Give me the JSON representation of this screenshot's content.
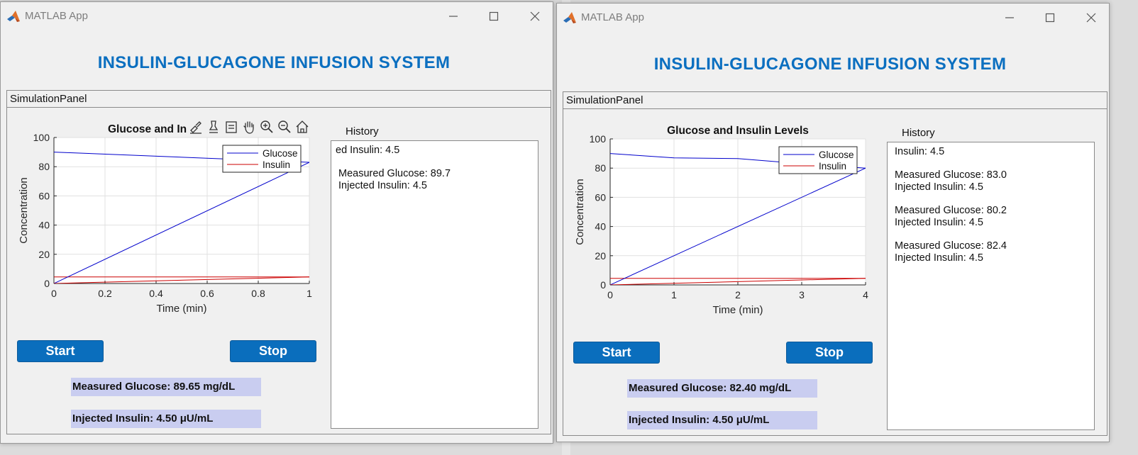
{
  "windows": [
    {
      "window_title": "MATLAB App",
      "app_title": "INSULIN-GLUCAGONE INFUSION SYSTEM",
      "panel_title": "SimulationPanel",
      "chart_title_visible": "Glucose and In",
      "history_label": "History",
      "history_lines": [
        "ed Insulin: 4.5",
        "",
        " Measured Glucose: 89.7",
        " Injected Insulin: 4.5"
      ],
      "start_label": "Start",
      "stop_label": "Stop",
      "glucose_readout": "Measured Glucose: 89.65 mg/dL",
      "insulin_readout": "Injected Insulin: 4.50 μU/mL",
      "axes_toolbar_icons": [
        "brush-icon",
        "data-tips-icon",
        "restore-icon",
        "pan-icon",
        "zoom-in-icon",
        "zoom-out-icon",
        "home-icon"
      ]
    },
    {
      "window_title": "MATLAB App",
      "app_title": "INSULIN-GLUCAGONE INFUSION SYSTEM",
      "panel_title": "SimulationPanel",
      "chart_title_visible": "Glucose and Insulin Levels",
      "history_label": "History",
      "history_lines": [
        "Insulin: 4.5",
        "",
        "Measured Glucose: 83.0",
        "Injected Insulin: 4.5",
        "",
        "Measured Glucose: 80.2",
        "Injected Insulin: 4.5",
        "",
        "Measured Glucose: 82.4",
        "Injected Insulin: 4.5"
      ],
      "start_label": "Start",
      "stop_label": "Stop",
      "glucose_readout": "Measured Glucose: 82.40 mg/dL",
      "insulin_readout": "Injected Insulin: 4.50 μU/mL",
      "axes_toolbar_icons": []
    }
  ],
  "chart_data": [
    {
      "type": "line",
      "title": "Glucose and Insulin Levels",
      "xlabel": "Time (min)",
      "ylabel": "Concentration",
      "xlim": [
        0,
        1
      ],
      "ylim": [
        0,
        100
      ],
      "xticks": [
        0,
        0.2,
        0.4,
        0.6,
        0.8,
        1
      ],
      "xtick_labels": [
        "0",
        "0.2",
        "0.4",
        "0.6",
        "0.8",
        "1"
      ],
      "yticks": [
        0,
        20,
        40,
        60,
        80,
        100
      ],
      "grid": true,
      "legend": "top-right",
      "series": [
        {
          "name": "Glucose",
          "color": "#0000cc",
          "x": [
            0,
            1
          ],
          "y": [
            90,
            83
          ]
        },
        {
          "name": "Insulin",
          "color": "#cc0000",
          "x": [
            0,
            1
          ],
          "y": [
            4.5,
            4.5
          ]
        },
        {
          "name": "",
          "color": "#0000cc",
          "x": [
            0,
            1
          ],
          "y": [
            0,
            83
          ]
        },
        {
          "name": "",
          "color": "#cc0000",
          "x": [
            0,
            1
          ],
          "y": [
            0,
            4.5
          ]
        }
      ],
      "colors": {
        "glucose": "#0000cc",
        "insulin": "#cc0000"
      }
    },
    {
      "type": "line",
      "title": "Glucose and Insulin Levels",
      "xlabel": "Time (min)",
      "ylabel": "Concentration",
      "xlim": [
        0,
        4
      ],
      "ylim": [
        0,
        100
      ],
      "xticks": [
        0,
        1,
        2,
        3,
        4
      ],
      "xtick_labels": [
        "0",
        "1",
        "2",
        "3",
        "4"
      ],
      "yticks": [
        0,
        20,
        40,
        60,
        80,
        100
      ],
      "grid": true,
      "legend": "top-right",
      "series": [
        {
          "name": "Glucose",
          "color": "#0000cc",
          "x": [
            0,
            1,
            2,
            3,
            4
          ],
          "y": [
            90,
            87,
            86.5,
            83,
            80
          ]
        },
        {
          "name": "Insulin",
          "color": "#cc0000",
          "x": [
            0,
            1,
            2,
            3,
            4
          ],
          "y": [
            4.5,
            4.5,
            4.5,
            4.5,
            4.5
          ]
        },
        {
          "name": "",
          "color": "#0000cc",
          "x": [
            0,
            4
          ],
          "y": [
            0,
            80
          ]
        },
        {
          "name": "",
          "color": "#cc0000",
          "x": [
            0,
            4
          ],
          "y": [
            0,
            4.5
          ]
        }
      ],
      "colors": {
        "glucose": "#0000cc",
        "insulin": "#cc0000"
      }
    }
  ]
}
